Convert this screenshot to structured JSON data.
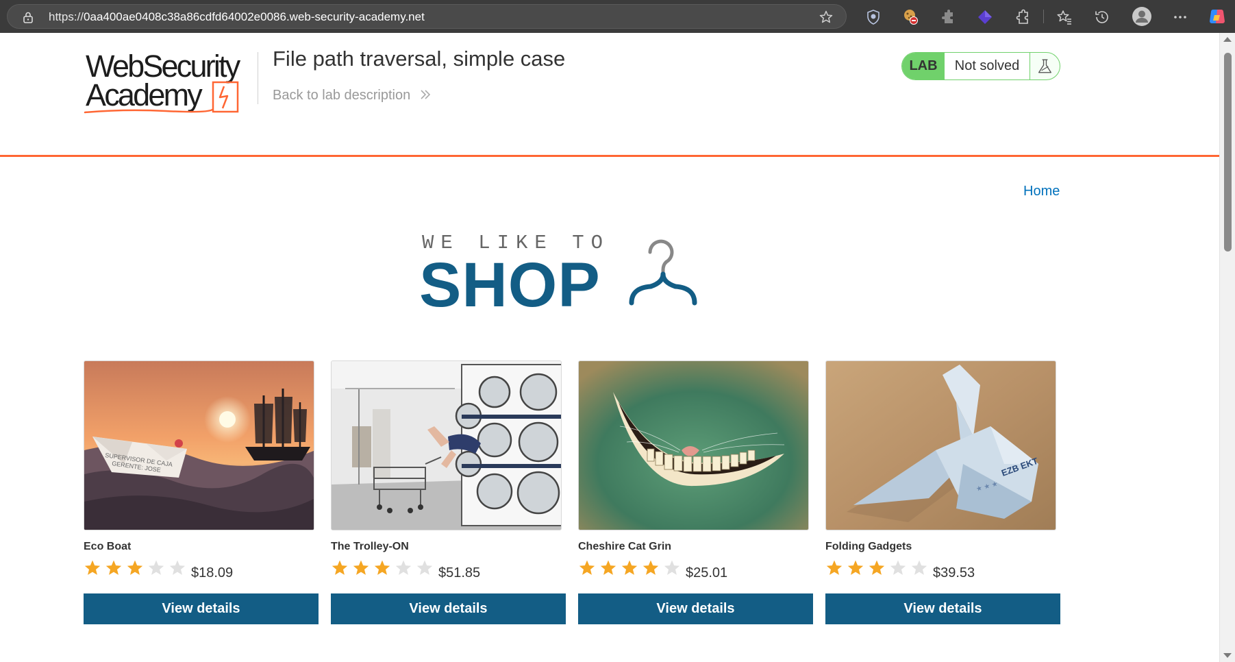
{
  "browser": {
    "url_prefix": "https://",
    "url_host": "0aa400ae0408c38a86cdfd64002e0086.web-security-academy.net",
    "icons": [
      "lock-icon",
      "favorite-star-icon",
      "shield-extension-icon",
      "cookie-extension-icon",
      "puzzle-extension-icon",
      "diamond-extension-icon",
      "extensions-icon",
      "favorites-icon",
      "history-icon",
      "profile-icon",
      "more-icon",
      "copilot-icon"
    ]
  },
  "header": {
    "logo_line1": "WebSecurity",
    "logo_line2": "Academy",
    "lab_title": "File path traversal, simple case",
    "back_link": "Back to lab description",
    "lab_label": "LAB",
    "lab_status": "Not solved",
    "accent_color": "#ff6633",
    "lab_color": "#70d16b"
  },
  "nav": {
    "home": "Home"
  },
  "banner": {
    "line1": "WE LIKE TO",
    "line2": "SHOP"
  },
  "products": [
    {
      "name": "Eco Boat",
      "rating": 3,
      "price": "$18.09",
      "button": "View details"
    },
    {
      "name": "The Trolley-ON",
      "rating": 3,
      "price": "$51.85",
      "button": "View details"
    },
    {
      "name": "Cheshire Cat Grin",
      "rating": 4,
      "price": "$25.01",
      "button": "View details"
    },
    {
      "name": "Folding Gadgets",
      "rating": 3,
      "price": "$39.53",
      "button": "View details"
    }
  ],
  "theme": {
    "button_color": "#135d85",
    "link_color": "#0071bc",
    "star_filled": "#f5a623",
    "star_empty": "#e0e0e0"
  }
}
